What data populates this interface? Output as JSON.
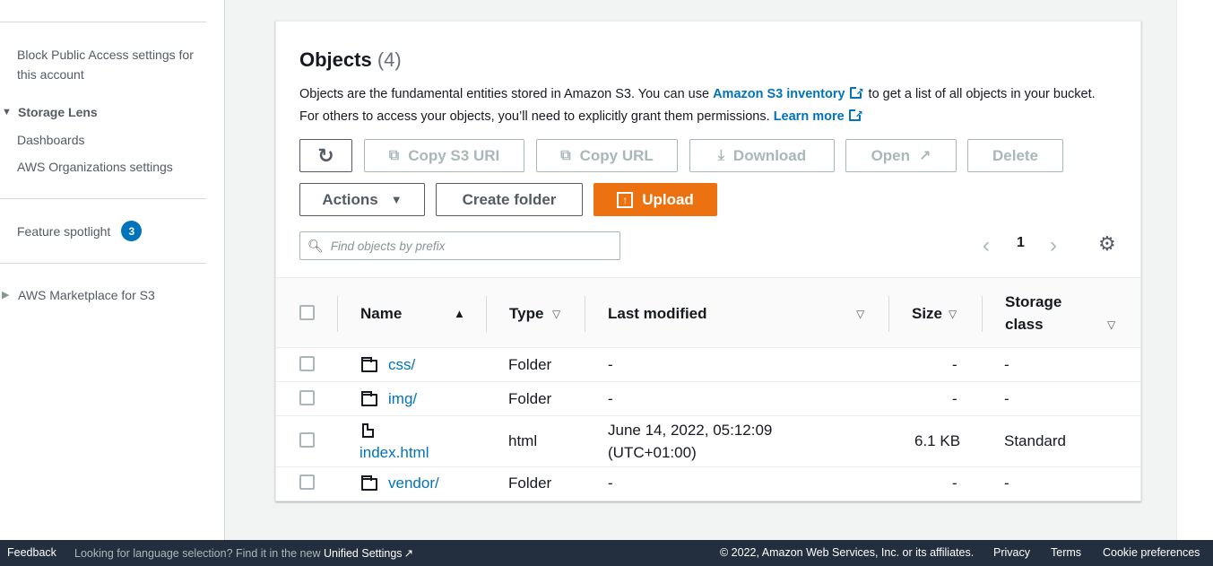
{
  "sidebar": {
    "block_public_access": "Block Public Access settings for this account",
    "storage_lens": "Storage Lens",
    "dashboards": "Dashboards",
    "aws_org_settings": "AWS Organizations settings",
    "feature_spotlight": "Feature spotlight",
    "feature_spotlight_count": "3",
    "marketplace": "AWS Marketplace for S3"
  },
  "objects": {
    "title": "Objects",
    "count": "(4)",
    "desc_part1": "Objects are the fundamental entities stored in Amazon S3. You can use ",
    "desc_link1": "Amazon S3 inventory",
    "desc_part2": " to get a list of all objects in your bucket. For others to access your objects, you’ll need to explicitly grant them permissions. ",
    "desc_link2": "Learn more"
  },
  "toolbar": {
    "refresh_icon": "refresh-icon",
    "copy_s3_uri": "Copy S3 URI",
    "copy_url": "Copy URL",
    "download": "Download",
    "open": "Open",
    "delete": "Delete",
    "actions": "Actions",
    "create_folder": "Create folder",
    "upload": "Upload"
  },
  "search": {
    "placeholder": "Find objects by prefix"
  },
  "pagination": {
    "page": "1"
  },
  "table": {
    "columns": [
      "Name",
      "Type",
      "Last modified",
      "Size",
      "Storage class"
    ],
    "rows": [
      {
        "name": "css/",
        "type": "Folder",
        "last_modified": "-",
        "size": "-",
        "storage_class": "-"
      },
      {
        "name": "img/",
        "type": "Folder",
        "last_modified": "-",
        "size": "-",
        "storage_class": "-"
      },
      {
        "name": "index.html",
        "type": "html",
        "last_modified_line1": "June 14, 2022, 05:12:09",
        "last_modified_line2": "(UTC+01:00)",
        "size": "6.1 KB",
        "storage_class": "Standard"
      },
      {
        "name": "vendor/",
        "type": "Folder",
        "last_modified": "-",
        "size": "-",
        "storage_class": "-"
      }
    ]
  },
  "footer": {
    "feedback": "Feedback",
    "language_text": "Looking for language selection? Find it in the new ",
    "unified_settings": "Unified Settings",
    "copyright": "© 2022, Amazon Web Services, Inc. or its affiliates.",
    "privacy": "Privacy",
    "terms": "Terms",
    "cookie": "Cookie preferences"
  },
  "colors": {
    "accent": "#0073bb",
    "upload": "#ec7211",
    "footer_bg": "#232f3e"
  }
}
